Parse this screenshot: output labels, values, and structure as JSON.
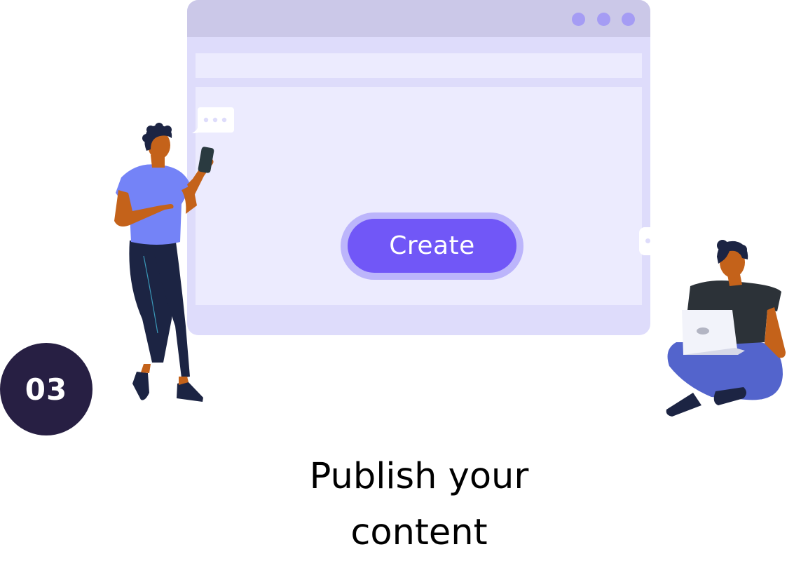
{
  "window": {
    "dots": [
      "dot",
      "dot",
      "dot"
    ]
  },
  "create_button": {
    "label": "Create"
  },
  "step": {
    "number": "03"
  },
  "caption": {
    "text": "Publish your content"
  },
  "colors": {
    "accent": "#7157f7",
    "accent_ring": "#bcb5fb",
    "window_body": "#dedcfb",
    "window_header": "#cbc8e8",
    "window_panel": "#ecebfe",
    "header_dots": "#a59cf4",
    "badge_bg": "#271f43"
  },
  "icons": {
    "chat_bubble": "chat-bubble-icon",
    "window_dots": "window-control-dot-icon"
  }
}
